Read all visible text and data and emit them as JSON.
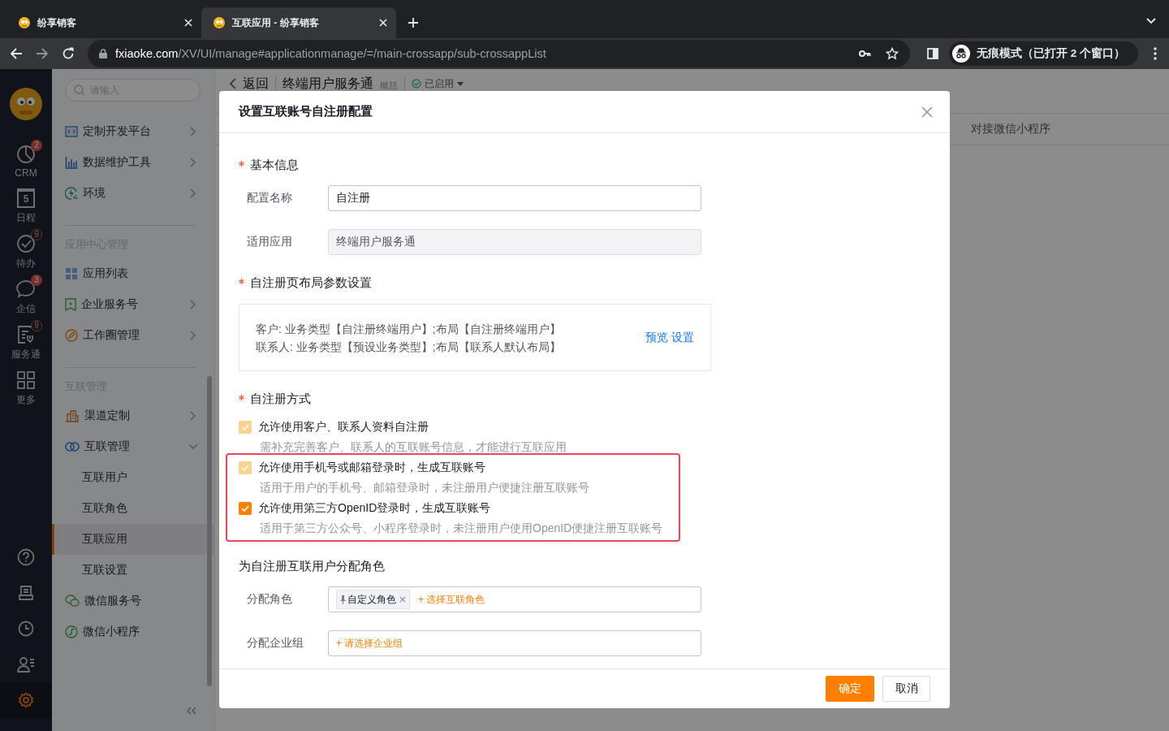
{
  "browser": {
    "tabs": [
      {
        "title": "纷享销客",
        "selected": false
      },
      {
        "title": "互联应用 - 纷享销客",
        "selected": true
      }
    ],
    "address": {
      "host": "fxiaoke.com",
      "path": "/XV/UI/manage#applicationmanage/=/main-crossapp/sub-crossappList"
    },
    "profile": "无痕模式（已打开 2 个窗口）"
  },
  "rail": {
    "items": [
      {
        "label": "CRM",
        "badge": "2",
        "kind": "filled"
      },
      {
        "label": "日程",
        "date": "5"
      },
      {
        "label": "待办",
        "badge": "9",
        "kind": "outline"
      },
      {
        "label": "企信",
        "badge": "3",
        "kind": "filled"
      },
      {
        "label": "服务通",
        "badge": "9",
        "kind": "outline"
      },
      {
        "label": "更多"
      }
    ],
    "tools": [
      {
        "selected": false
      },
      {
        "selected": false
      },
      {
        "selected": false
      },
      {
        "selected": false
      },
      {
        "selected": true
      }
    ]
  },
  "sidebar": {
    "search": {
      "placeholder": "请输入"
    },
    "groups": [
      {
        "items": [
          {
            "label": "定制开发平台",
            "selected": false,
            "expanded": false
          },
          {
            "label": "数据维护工具",
            "selected": false,
            "expanded": false
          },
          {
            "label": "环境",
            "selected": false,
            "expanded": false
          }
        ]
      },
      {
        "title": "应用中心管理",
        "items": [
          {
            "label": "应用列表",
            "selected": false
          },
          {
            "label": "企业服务号",
            "selected": false,
            "expanded": false
          },
          {
            "label": "工作圈管理",
            "selected": false,
            "expanded": false
          }
        ]
      },
      {
        "title": "互联管理",
        "items": [
          {
            "label": "渠道定制",
            "selected": false,
            "expanded": false
          },
          {
            "label": "互联管理",
            "selected": false,
            "expanded": true,
            "children": [
              {
                "label": "互联用户",
                "selected": false
              },
              {
                "label": "互联角色",
                "selected": false
              },
              {
                "label": "互联应用",
                "selected": true
              },
              {
                "label": "互联设置",
                "selected": false
              }
            ]
          },
          {
            "label": "微信服务号",
            "selected": false
          },
          {
            "label": "微信小程序",
            "selected": false
          }
        ]
      }
    ]
  },
  "page": {
    "back": "返回",
    "title": "终端用户服务通",
    "subtitle": "概括",
    "status": "已启用",
    "tabs": [
      "对接微信小程序"
    ]
  },
  "modal": {
    "title": "设置互联账号自注册配置",
    "sections": [
      {
        "kind": "fields",
        "title": "基本信息",
        "required": true,
        "fields": [
          {
            "label": "配置名称",
            "value": "自注册",
            "disabled": false
          },
          {
            "label": "适用应用",
            "value": "终端用户服务通",
            "disabled": true
          }
        ]
      },
      {
        "kind": "layout",
        "title": "自注册页布局参数设置",
        "required": true,
        "lines": [
          "客户: 业务类型【自注册终端用户】;布局【自注册终端用户】",
          "联系人: 业务类型【预设业务类型】;布局【联系人默认布局】"
        ],
        "links": [
          "预览",
          "设置"
        ]
      },
      {
        "kind": "options",
        "title": "自注册方式",
        "required": true,
        "options": [
          {
            "label": "允许使用客户、联系人资料自注册",
            "hint": "需补充完善客户、联系人的互联账号信息，才能进行互联应用",
            "checked": true,
            "disabled": true,
            "highlighted": false
          },
          {
            "label": "允许使用手机号或邮箱登录时，生成互联账号",
            "hint": "适用于用户的手机号、邮箱登录时，未注册用户便捷注册互联账号",
            "checked": true,
            "disabled": true,
            "highlighted": true
          },
          {
            "label": "允许使用第三方OpenID登录时，生成互联账号",
            "hint": "适用于第三方公众号、小程序登录时，未注册用户使用OpenID便捷注册互联账号",
            "checked": true,
            "disabled": false,
            "highlighted": true
          }
        ]
      },
      {
        "kind": "pickers",
        "title": "为自注册互联用户分配角色",
        "required": false,
        "fields": [
          {
            "label": "分配角色",
            "tags": [
              "自定义角色"
            ],
            "add": "+ 选择互联角色"
          },
          {
            "label": "分配企业组",
            "add": "+ 请选择企业组"
          }
        ]
      }
    ],
    "buttons": [
      {
        "label": "确定",
        "kind": "primary"
      },
      {
        "label": "取消",
        "kind": "default"
      }
    ]
  }
}
